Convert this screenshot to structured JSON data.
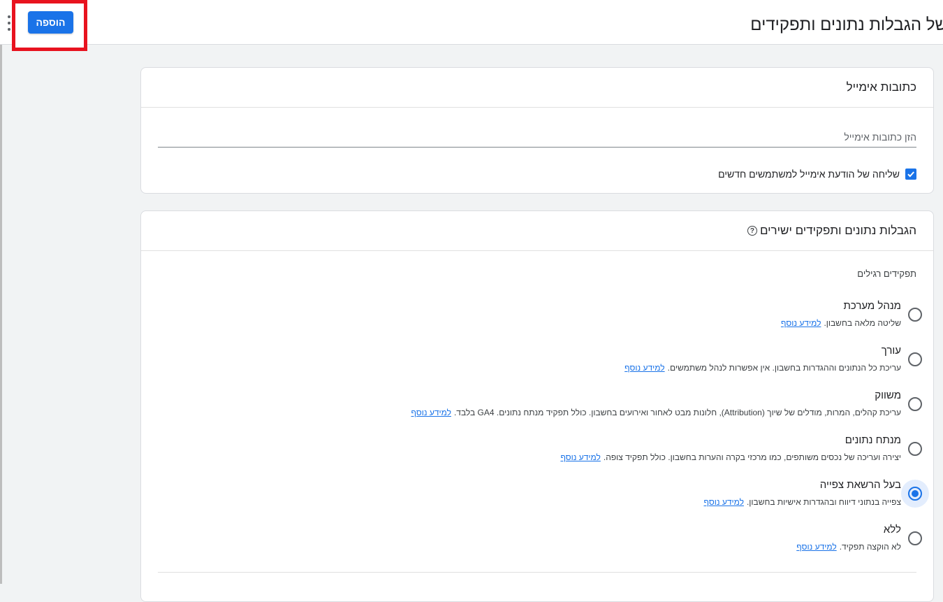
{
  "header": {
    "title": "של הגבלות נתונים ותפקידים",
    "add_label": "הוספה"
  },
  "email_section": {
    "title": "כתובות אימייל",
    "placeholder": "הזן כתובות אימייל",
    "notify_label": "שליחה של הודעת אימייל למשתמשים חדשים",
    "notify_checked": true
  },
  "roles_section": {
    "title": "הגבלות נתונים ותפקידים ישירים",
    "standard_label": "תפקידים רגילים",
    "learn_more": "למידע נוסף",
    "roles": [
      {
        "name": "מנהל מערכת",
        "desc": "שליטה מלאה בחשבון.",
        "selected": false
      },
      {
        "name": "עורך",
        "desc": "עריכת כל הנתונים וההגדרות בחשבון. אין אפשרות לנהל משתמשים.",
        "selected": false
      },
      {
        "name": "משווק",
        "desc": "עריכת קהלים, המרות, מודלים של שיוך (Attribution), חלונות מבט לאחור ואירועים בחשבון. כולל תפקיד מנתח נתונים. GA4 בלבד.",
        "selected": false
      },
      {
        "name": "מנתח נתונים",
        "desc": "יצירה ועריכה של נכסים משותפים, כמו מרכזי בקרה והערות בחשבון. כולל תפקיד צופה.",
        "selected": false
      },
      {
        "name": "בעל הרשאת צפייה",
        "desc": "צפייה בנתוני דיווח ובהגדרות אישיות בחשבון.",
        "selected": true
      },
      {
        "name": "ללא",
        "desc": "לא הוקצה תפקיד.",
        "selected": false
      }
    ]
  },
  "colors": {
    "accent": "#1a73e8",
    "highlight": "#e8131f"
  }
}
